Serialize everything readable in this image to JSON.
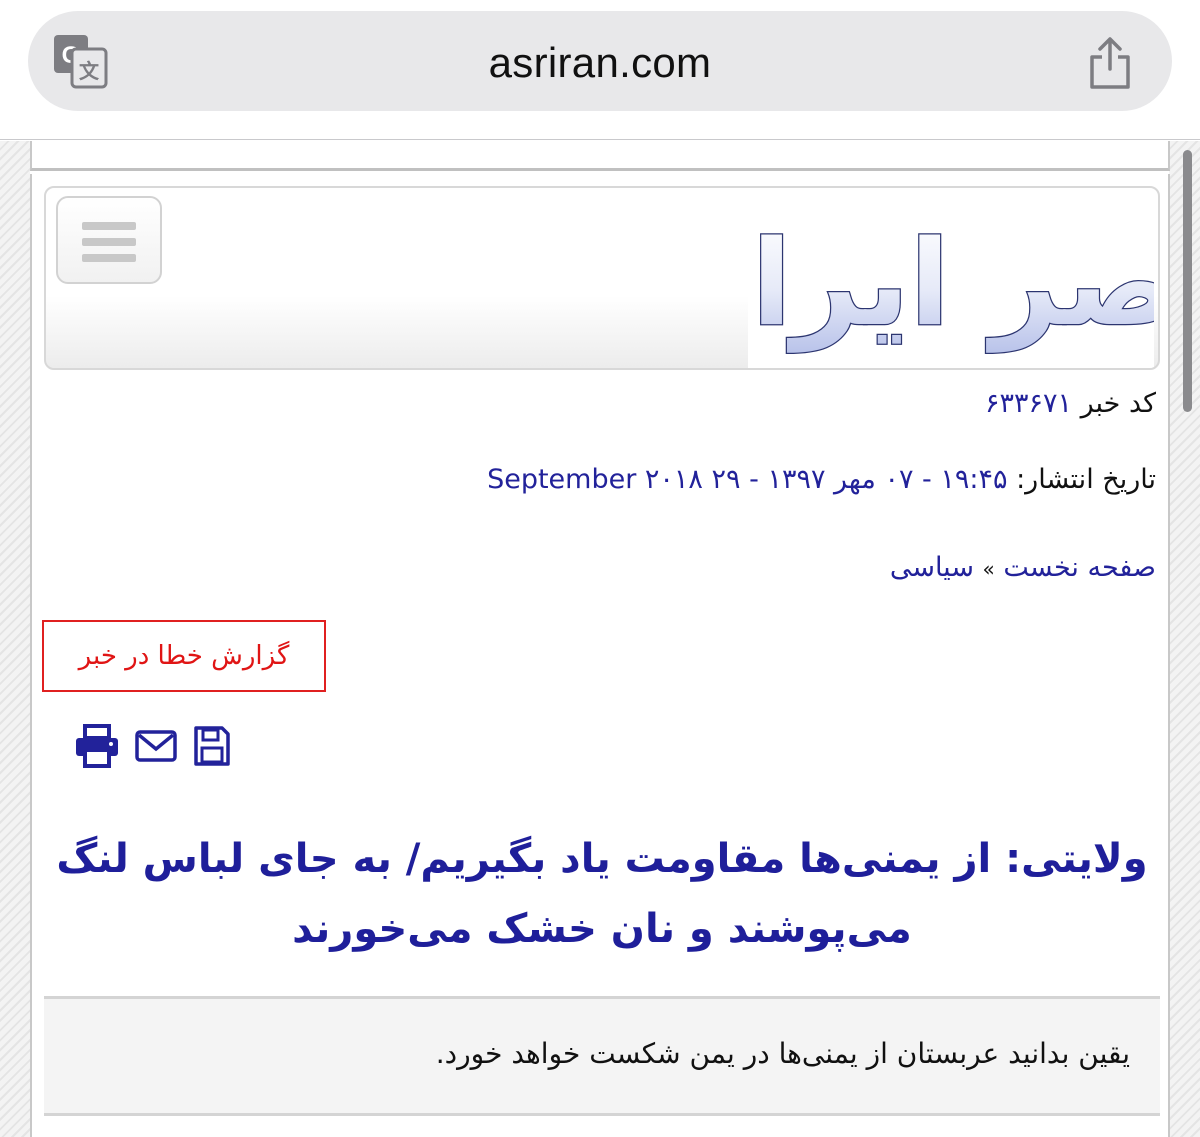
{
  "browser": {
    "url": "asriran.com",
    "translate_icon": "translate-icon",
    "share_icon": "share-icon"
  },
  "site": {
    "logo_text": "عصر ایران",
    "menu_icon": "hamburger-menu-icon"
  },
  "article": {
    "code_label": "کد خبر",
    "code_value": "۶۳۳۶۷۱",
    "date_label": "تاریخ انتشار:",
    "date_value": "۱۹:۴۵ - ۰۷ مهر ۱۳۹۷ - ۲۹ September ۲۰۱۸",
    "breadcrumb_home": "صفحه نخست",
    "breadcrumb_sep": "»",
    "breadcrumb_section": "سیاسی",
    "report_error": "گزارش خطا در خبر",
    "tools": {
      "print_icon": "print-icon",
      "email_icon": "email-icon",
      "save_icon": "save-icon"
    },
    "headline": "ولایتی: از یمنی‌ها مقاومت یاد بگیریم/ به جای لباس لنگ می‌پوشند و نان خشک می‌خورند",
    "lead": "یقین بدانید عربستان از یمنی‌ها در یمن شکست خواهد خورد."
  },
  "colors": {
    "link_blue": "#22229a",
    "headline_blue": "#1f1f9a",
    "report_red": "#e01515"
  }
}
